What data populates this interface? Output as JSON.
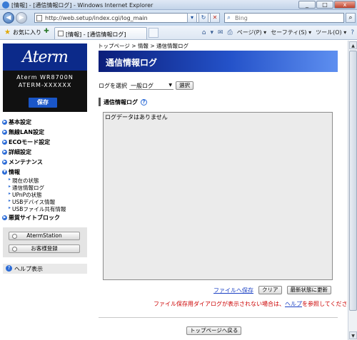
{
  "window": {
    "title": "[情報] - [通信情報ログ] - Windows Internet Explorer",
    "min": "_",
    "max": "□",
    "close": "x"
  },
  "address": {
    "url": "http://web.setup/index.cgi/log_main",
    "search_placeholder": "Bing"
  },
  "favorites": {
    "label": "お気に入り",
    "tab_label": "[情報] - [通信情報ログ]",
    "commands": [
      "ページ(P) ▾",
      "セーフティ(S) ▾",
      "ツール(O) ▾"
    ]
  },
  "sidebar": {
    "logo": "Aterm",
    "model_line1": "Aterm WR8700N",
    "model_line2": "ATERM-XXXXXX",
    "save_label": "保存",
    "menu": [
      {
        "label": "基本設定"
      },
      {
        "label": "無線LAN設定"
      },
      {
        "label": "ECOモード設定"
      },
      {
        "label": "詳細設定"
      },
      {
        "label": "メンテナンス"
      },
      {
        "label": "情報"
      }
    ],
    "info_submenu": [
      "現在の状態",
      "通信情報ログ",
      "UPnPの状態",
      "USBデバイス情報",
      "USBファイル共有情報"
    ],
    "last_menu": "悪質サイトブロック",
    "aterm_station": "AtermStation",
    "customer_reg": "お客様登録",
    "help": "ヘルプ表示"
  },
  "main": {
    "breadcrumb": [
      "トップページ",
      "情報",
      "通信情報ログ"
    ],
    "breadcrumb_sep": ">",
    "title": "通信情報ログ",
    "select_label": "ログを選択",
    "select_value": "一般ログ",
    "select_button": "選択",
    "section_title": "通信情報ログ",
    "log_text": "ログデータはありません",
    "save_link": "ファイルへ保存",
    "clear_button": "クリア",
    "refresh_button": "最新状態に更新",
    "notice_pre": "ファイル保存用ダイアログが表示されない場合は、",
    "notice_link": "ヘルプ",
    "notice_post": "を参照してください。",
    "top_button": "トップページへ戻る"
  }
}
